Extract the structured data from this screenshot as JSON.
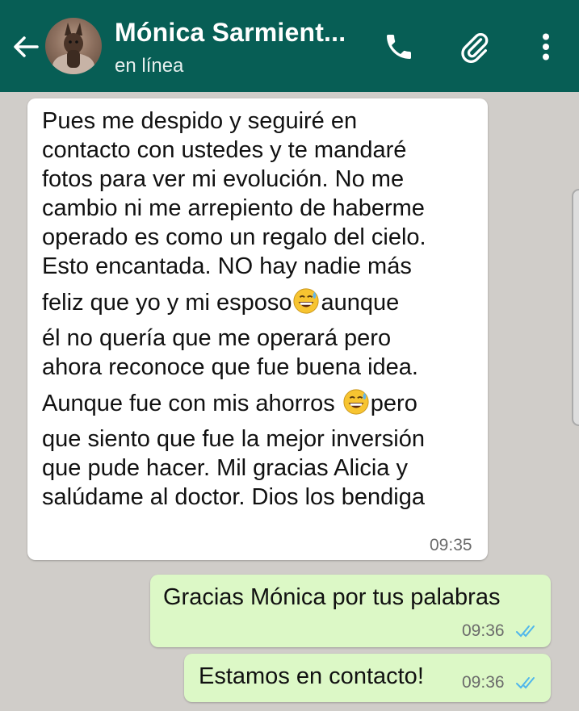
{
  "header": {
    "contact_name": "Mónica Sarmient...",
    "status": "en línea",
    "icons": [
      "back-arrow-icon",
      "phone-icon",
      "paperclip-icon",
      "more-vert-icon"
    ],
    "bg_color": "#075e55"
  },
  "messages": [
    {
      "direction": "incoming",
      "lines": [
        "Pues me despido y seguiré en",
        "contacto con ustedes y te mandaré",
        "fotos para ver mi evolución.  No me",
        "cambio ni me arrepiento de haberme",
        "operado es como un regalo del cielo.",
        "Esto encantada. NO hay nadie más",
        "feliz que yo y mi esposo",
        "aunque",
        "él no quería que me operará pero",
        "ahora reconoce que fue buena idea.",
        "Aunque fue con mis ahorros",
        "pero",
        "que siento que fue la mejor inversión",
        "que pude hacer.  Mil gracias Alicia y",
        "salúdame al doctor.  Dios los bendiga"
      ],
      "time": "09:35"
    },
    {
      "direction": "outgoing",
      "text": "Gracias Mónica por tus palabras",
      "time": "09:36",
      "read": true
    },
    {
      "direction": "outgoing",
      "text": "Estamos en contacto!",
      "time": "09:36",
      "read": true
    }
  ],
  "colors": {
    "chat_background": "#d0cdc9",
    "incoming_bubble": "#ffffff",
    "outgoing_bubble": "#dcf8c6",
    "read_ticks": "#4fb6ec"
  }
}
